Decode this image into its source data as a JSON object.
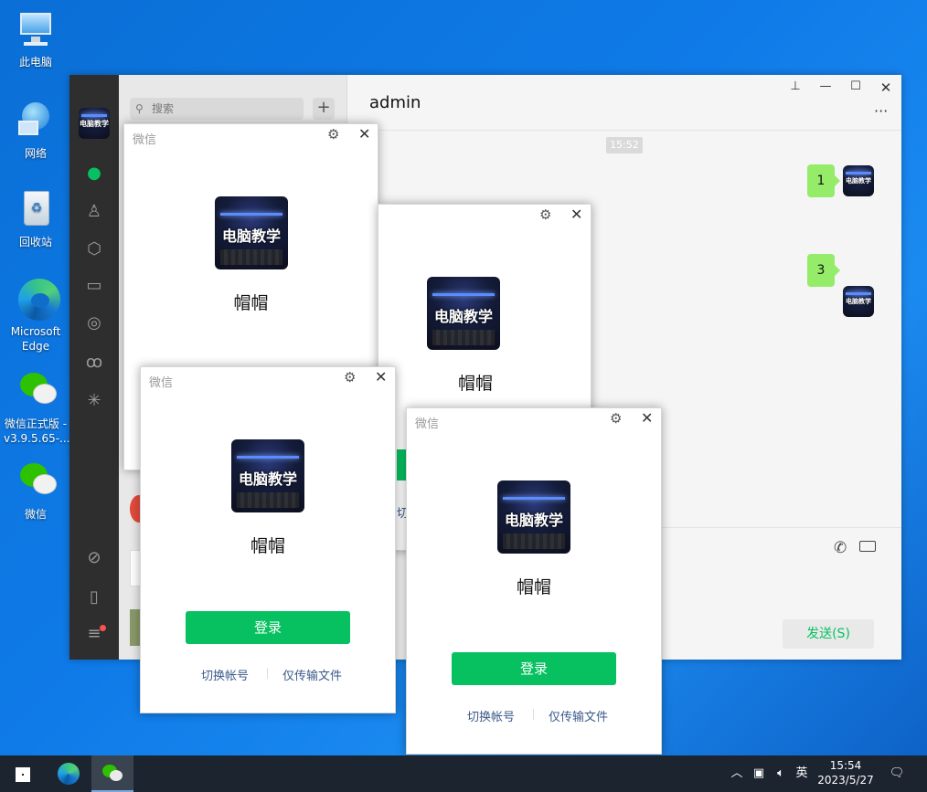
{
  "desktop": {
    "icons": [
      {
        "label": "此电脑",
        "icon": "computer-icon"
      },
      {
        "label": "网络",
        "icon": "network-icon"
      },
      {
        "label": "回收站",
        "icon": "recycle-bin-icon"
      },
      {
        "label": "Microsoft Edge",
        "icon": "edge-icon"
      },
      {
        "label": "微信正式版 -v3.9.5.65-...",
        "icon": "wechat-icon"
      },
      {
        "label": "微信",
        "icon": "wechat-icon"
      }
    ]
  },
  "main_window": {
    "search_placeholder": "搜索",
    "add_label": "+",
    "chat_title": "admin",
    "more_label": "···",
    "timestamp": "15:52",
    "messages": [
      {
        "text": "1"
      },
      {
        "text": "3"
      }
    ],
    "send_label": "发送(S)",
    "sidebar_icons": [
      "chat-icon",
      "contacts-icon",
      "favorites-icon",
      "files-icon",
      "moments-icon",
      "channels-icon",
      "discover-icon",
      "mini-program-icon",
      "phone-icon",
      "menu-icon"
    ]
  },
  "avatar_text": "电脑教学",
  "dialogs": [
    {
      "title": "微信",
      "name": "帽帽",
      "login": "",
      "switch": "",
      "transfer": ""
    },
    {
      "title": "",
      "name": "帽帽",
      "login": "",
      "switch": "",
      "transfer": ""
    },
    {
      "title": "微信",
      "name": "帽帽",
      "login": "登录",
      "switch": "切换帐号",
      "transfer": "仅传输文件"
    },
    {
      "title": "微信",
      "name": "帽帽",
      "login": "登录",
      "switch": "切换帐号",
      "transfer": "仅传输文件"
    }
  ],
  "taskbar": {
    "time": "15:54",
    "date": "2023/5/27",
    "ime": "英"
  },
  "colors": {
    "wechat_green": "#07c160",
    "bubble_green": "#95ec69"
  }
}
